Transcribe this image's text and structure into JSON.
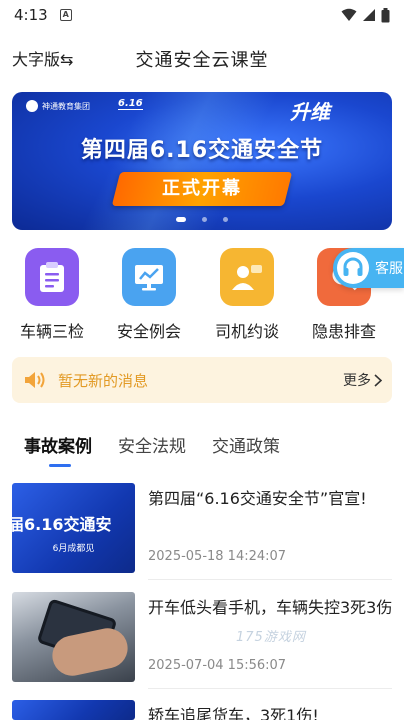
{
  "status_bar": {
    "time": "4:13",
    "notification_badge": "A"
  },
  "header": {
    "mode_button": "大字版⇆",
    "title": "交通安全云课堂"
  },
  "banner": {
    "logo_text": "神通教育集团",
    "event_logo_text": "6.16",
    "brand_text": "升维",
    "title": "第四届6.16交通安全节",
    "cta": "正式开幕",
    "dots": 3,
    "active_dot": 0
  },
  "quick_actions": [
    {
      "label": "车辆三检",
      "icon": "checklist-icon",
      "color": "#8a5cf0"
    },
    {
      "label": "安全例会",
      "icon": "chart-screen-icon",
      "color": "#4aa3f0"
    },
    {
      "label": "司机约谈",
      "icon": "driver-chat-icon",
      "color": "#f6b632"
    },
    {
      "label": "隐患排查",
      "icon": "hazard-search-icon",
      "color": "#f06a3c"
    }
  ],
  "service": {
    "label": "客服",
    "icon": "headset-icon"
  },
  "notice": {
    "text": "暂无新的消息",
    "more": "更多"
  },
  "tabs": [
    {
      "label": "事故案例",
      "active": true
    },
    {
      "label": "安全法规",
      "active": false
    },
    {
      "label": "交通政策",
      "active": false
    }
  ],
  "news": [
    {
      "title": "第四届“6.16交通安全节”官宣!",
      "date": "2025-05-18 14:24:07",
      "thumb_text": "届6.16交通安",
      "thumb_sub": "6月成都见"
    },
    {
      "title": "开车低头看手机，车辆失控3死3伤",
      "date": "2025-07-04 15:56:07",
      "thumb_text": "",
      "thumb_sub": ""
    },
    {
      "title": "轿车追尾货车，3死1伤!",
      "date": "",
      "thumb_text": "",
      "thumb_sub": ""
    }
  ],
  "watermark": "175游戏网",
  "colors": {
    "accent": "#2f6ff0",
    "notice_bg": "#fdf3df",
    "notice_text": "#e29a25",
    "service": "#47b4f2"
  }
}
